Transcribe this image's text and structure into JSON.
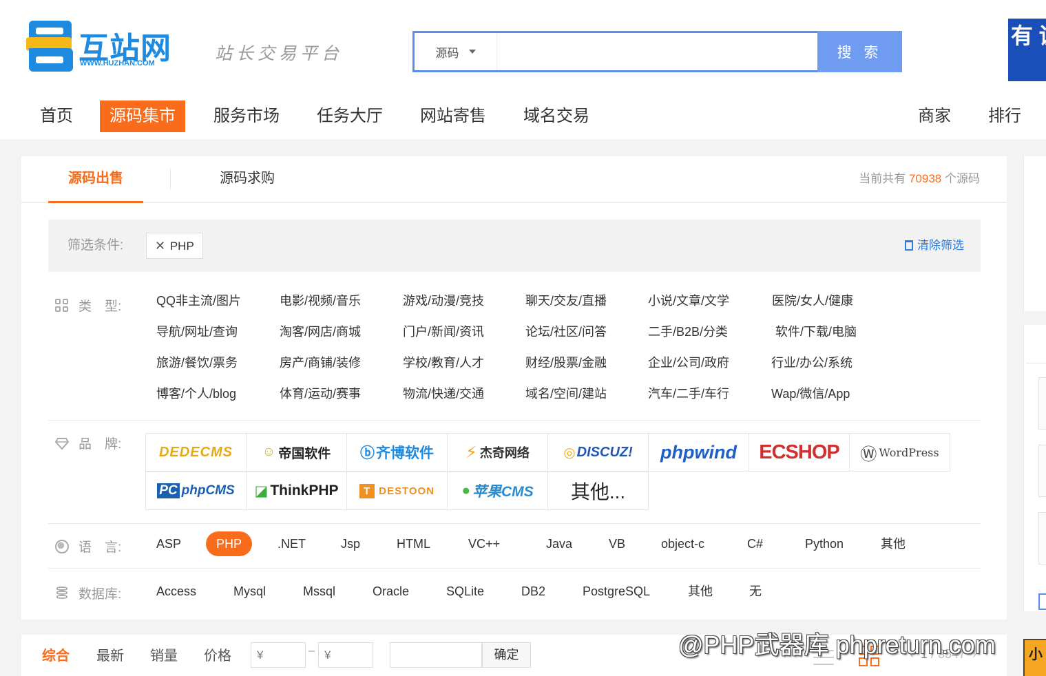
{
  "logo": {
    "name": "互站网",
    "url": "WWW.HUZHAN.COM"
  },
  "slogan": "站长交易平台",
  "search": {
    "category": "源码",
    "placeholder": "",
    "button": "搜 索"
  },
  "ad_banner": "有 诚",
  "nav": {
    "items": [
      "首页",
      "源码集市",
      "服务市场",
      "任务大厅",
      "网站寄售",
      "域名交易"
    ],
    "right": [
      "商家",
      "排行"
    ],
    "active_index": 1
  },
  "tabs": {
    "sale": "源码出售",
    "buy": "源码求购"
  },
  "total": {
    "prefix": "当前共有",
    "count": "70938",
    "suffix": "个源码"
  },
  "filter": {
    "label": "筛选条件:",
    "tag": "PHP",
    "clear": "清除筛选"
  },
  "type_row": {
    "label": "类　型:",
    "items": [
      [
        "QQ非主流/图片",
        "电影/视频/音乐",
        "游戏/动漫/竞技",
        "聊天/交友/直播",
        "小说/文章/文学",
        "医院/女人/健康"
      ],
      [
        "导航/网址/查询",
        "淘客/网店/商城",
        "门户/新闻/资讯",
        "论坛/社区/问答",
        "二手/B2B/分类",
        "软件/下载/电脑"
      ],
      [
        "旅游/餐饮/票务",
        "房产/商铺/装修",
        "学校/教育/人才",
        "财经/股票/金融",
        "企业/公司/政府",
        "行业/办公/系统"
      ],
      [
        "博客/个人/blog",
        "体育/运动/赛事",
        "物流/快递/交通",
        "域名/空间/建站",
        "汽车/二手/车行",
        "Wap/微信/App"
      ]
    ]
  },
  "brand_row": {
    "label": "品　牌:",
    "items": [
      "DEDECMS",
      "帝国软件",
      "齐博软件",
      "杰奇网络",
      "DISCUZ!",
      "phpwind",
      "ECSHOP",
      "WordPress",
      "phpCMS",
      "ThinkPHP",
      "DESTOON",
      "苹果CMS",
      "其他..."
    ]
  },
  "lang_row": {
    "label": "语　言:",
    "items": [
      "ASP",
      "PHP",
      ".NET",
      "Jsp",
      "HTML",
      "VC++",
      "Java",
      "VB",
      "object-c",
      "C#",
      "Python",
      "其他"
    ],
    "active_index": 1
  },
  "db_row": {
    "label": "数据库:",
    "items": [
      "Access",
      "Mysql",
      "Mssql",
      "Oracle",
      "SQLite",
      "DB2",
      "PostgreSQL",
      "其他",
      "无"
    ]
  },
  "sortbar": {
    "items": [
      "综合",
      "最新",
      "销量",
      "价格"
    ],
    "active_index": 0,
    "price_min": "¥",
    "price_max": "¥",
    "confirm": "确定",
    "page": "1",
    "page_total": "/ 3547"
  },
  "watermark": "@PHP武器库 phpreturn.com",
  "float_ad": "小",
  "colors": {
    "accent": "#f96c1b",
    "brand_blue": "#1e8be0",
    "search_blue": "#5b8ee8"
  }
}
